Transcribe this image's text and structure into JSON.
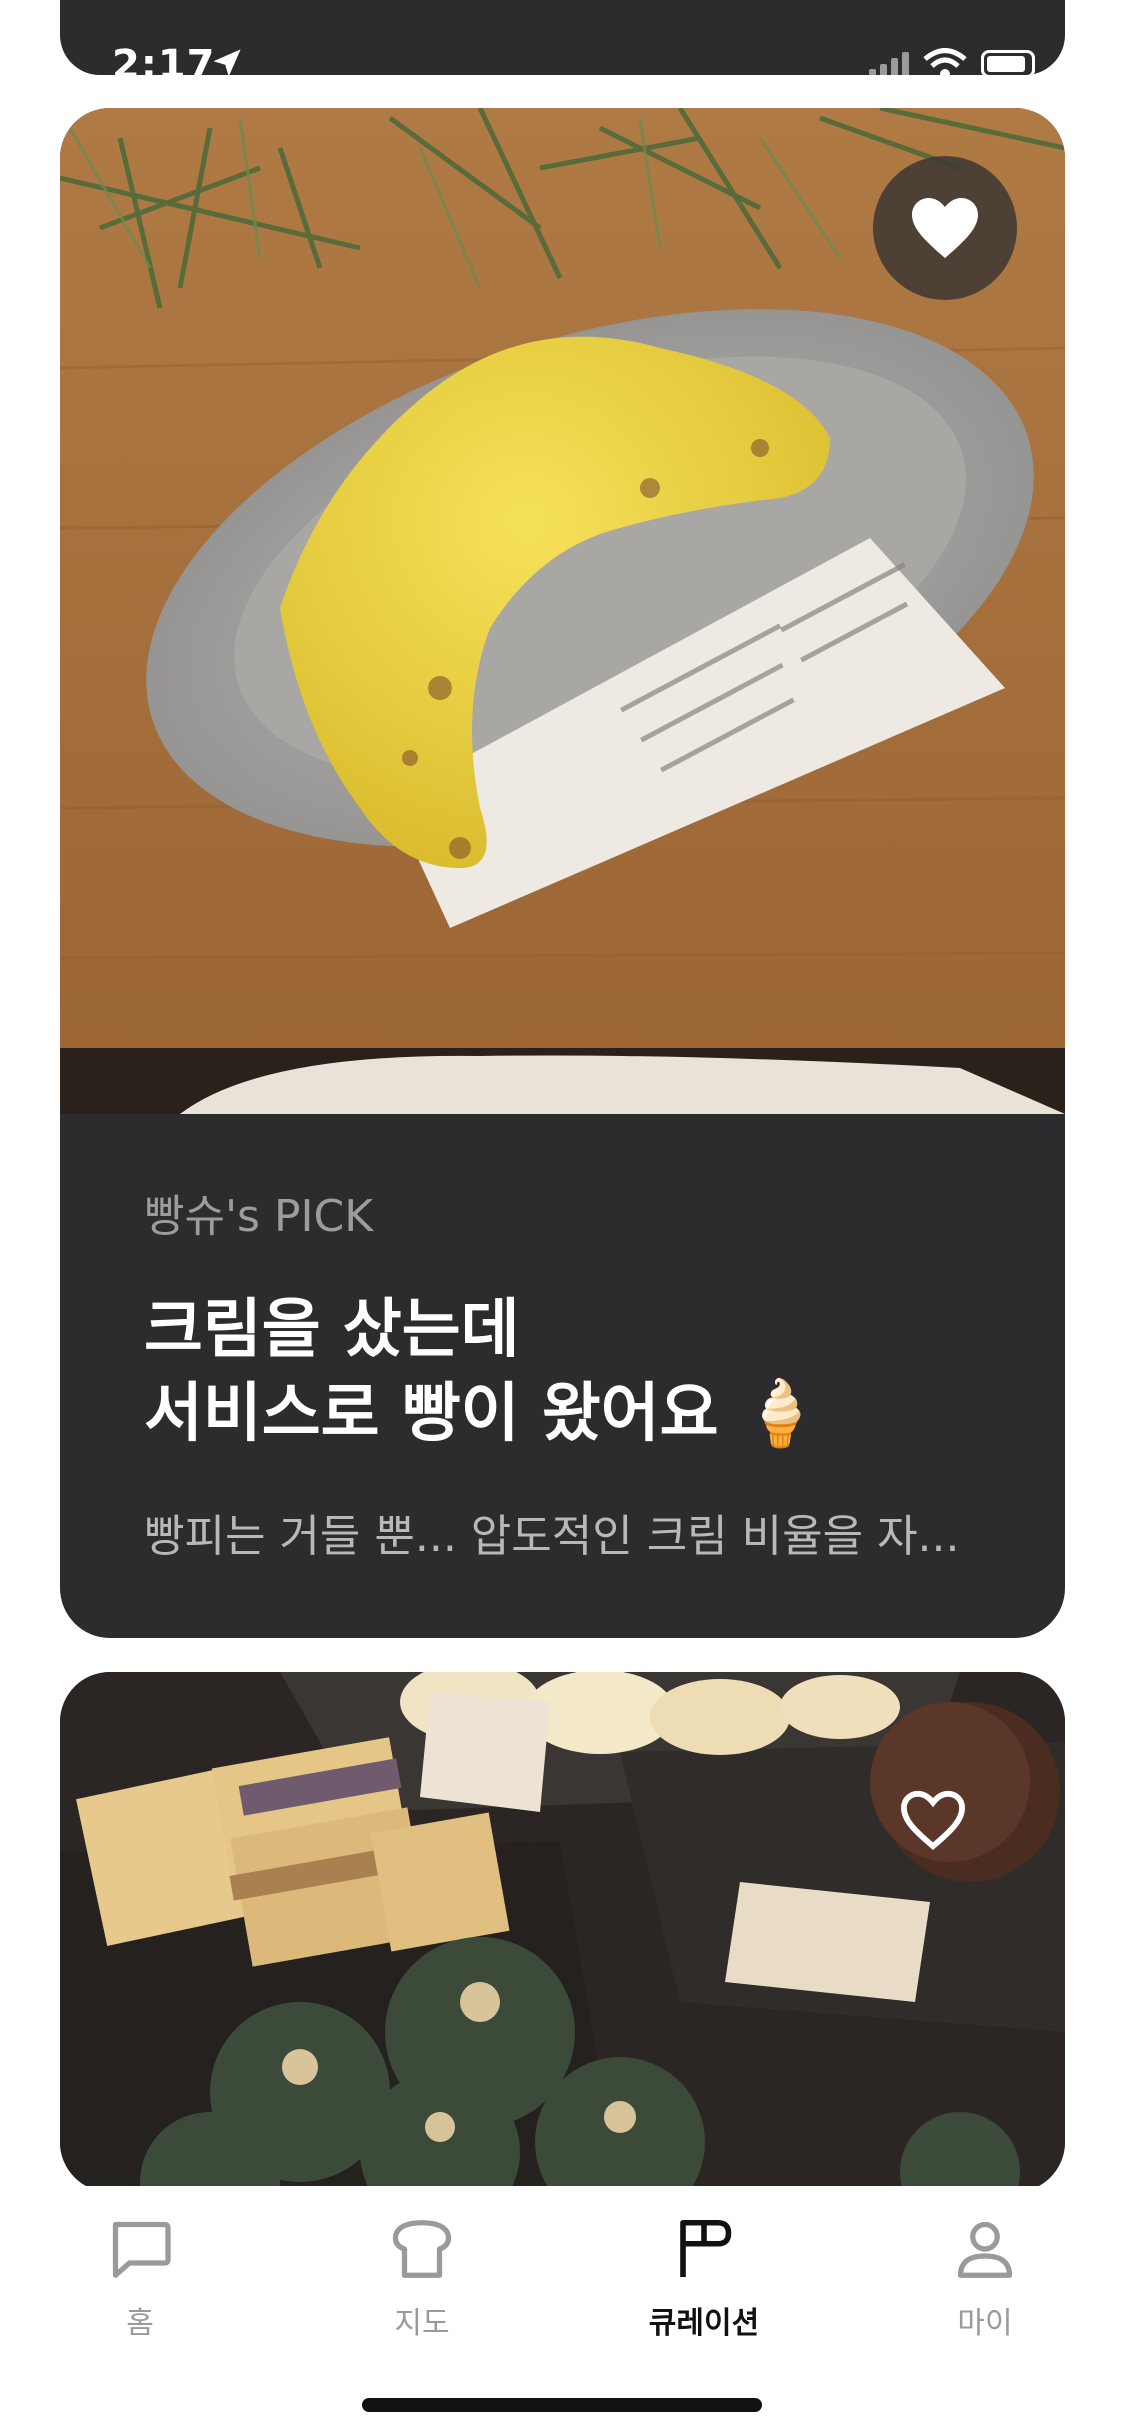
{
  "status_bar": {
    "time": "2:17"
  },
  "cards": [
    {
      "tag": "빵슈's PICK",
      "title_line1": "크림을 샀는데",
      "title_line2": "서비스로 빵이 왔어요 🍦",
      "description": "빵피는 거들 뿐... 압도적인 크림 비율을 자...",
      "favorited": true
    },
    {
      "favorited": false
    }
  ],
  "tabbar": {
    "items": [
      {
        "label": "홈",
        "icon": "chat-bubble-icon"
      },
      {
        "label": "지도",
        "icon": "bread-icon"
      },
      {
        "label": "큐레이션",
        "icon": "flag-icon",
        "active": true
      },
      {
        "label": "마이",
        "icon": "person-icon"
      }
    ]
  },
  "colors": {
    "card_bg": "#2c2c2e",
    "tag": "#9c9c9f",
    "active_tab": "#111111",
    "inactive_tab": "#9a9a9c"
  }
}
